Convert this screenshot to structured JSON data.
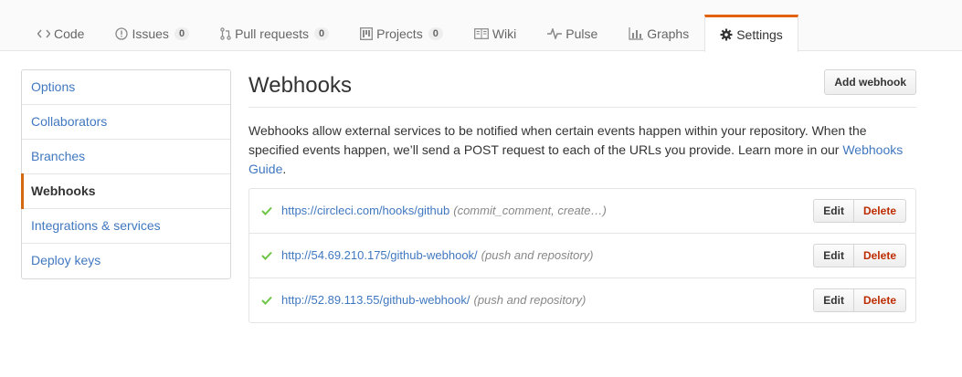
{
  "tabs": [
    {
      "label": "Code",
      "icon": "code-icon",
      "counter": null
    },
    {
      "label": "Issues",
      "icon": "issue-icon",
      "counter": "0"
    },
    {
      "label": "Pull requests",
      "icon": "pull-request-icon",
      "counter": "0"
    },
    {
      "label": "Projects",
      "icon": "project-icon",
      "counter": "0"
    },
    {
      "label": "Wiki",
      "icon": "book-icon",
      "counter": null
    },
    {
      "label": "Pulse",
      "icon": "pulse-icon",
      "counter": null
    },
    {
      "label": "Graphs",
      "icon": "graph-icon",
      "counter": null
    },
    {
      "label": "Settings",
      "icon": "gear-icon",
      "counter": null,
      "selected": true
    }
  ],
  "menu": {
    "items": [
      {
        "label": "Options"
      },
      {
        "label": "Collaborators"
      },
      {
        "label": "Branches"
      },
      {
        "label": "Webhooks",
        "selected": true
      },
      {
        "label": "Integrations & services"
      },
      {
        "label": "Deploy keys"
      }
    ]
  },
  "main": {
    "title": "Webhooks",
    "add_label": "Add webhook",
    "desc_text": "Webhooks allow external services to be notified when certain events happen within your repository. When the specified events happen, we’ll send a POST request to each of the URLs you provide. Learn more in our ",
    "desc_link": "Webhooks Guide",
    "desc_end": ".",
    "hooks": [
      {
        "url": "https://circleci.com/hooks/github",
        "events": "(commit_comment, create…)",
        "status": "active"
      },
      {
        "url": "http://54.69.210.175/github-webhook/",
        "events": "(push and repository)",
        "status": "active"
      },
      {
        "url": "http://52.89.113.55/github-webhook/",
        "events": "(push and repository)",
        "status": "active"
      }
    ],
    "edit_label": "Edit",
    "delete_label": "Delete"
  },
  "colors": {
    "link": "#4078c0",
    "selected_tab_border": "#e36209",
    "check": "#6cc644",
    "delete": "#bd2c00"
  }
}
